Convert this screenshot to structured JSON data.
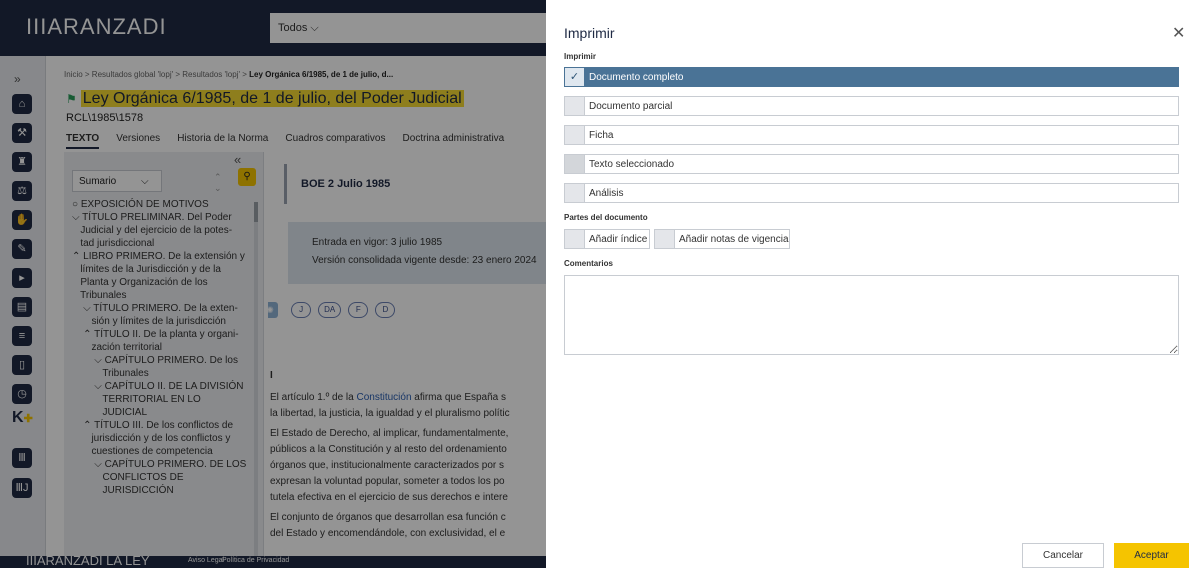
{
  "header": {
    "logo": "IIIARANZADI",
    "search_scope": "Todos ⌵"
  },
  "breadcrumb": {
    "text": "Inicio > Resultados global 'lopj' > Resultados 'lopj' > ",
    "current": "Ley Orgánica 6/1985, de 1 de julio, d..."
  },
  "document": {
    "title": "Ley Orgánica 6/1985, de 1 de julio, del Poder Judicial",
    "reference": "RCL\\1985\\1578",
    "tabs": [
      "TEXTO",
      "Versiones",
      "Historia de la Norma",
      "Cuadros comparativos",
      "Doctrina administrativa"
    ],
    "active_tab": "TEXTO"
  },
  "toc": {
    "select_value": "Sumario",
    "items": [
      "○ EXPOSICIÓN DE MOTIVOS",
      "⌵ TÍTULO PRELIMINAR. Del Poder",
      "   Judicial y del ejercicio de la potes-",
      "   tad jurisdiccional",
      "⌃ LIBRO PRIMERO. De la extensión y",
      "   límites de la Jurisdicción y de la",
      "   Planta y Organización de los",
      "   Tribunales",
      "    ⌵ TÍTULO PRIMERO. De la exten-",
      "       sión y límites de la jurisdicción",
      "    ⌃ TÍTULO II. De la planta y organi-",
      "       zación territorial",
      "        ⌵ CAPÍTULO PRIMERO. De los",
      "           Tribunales",
      "        ⌵ CAPÍTULO II. DE LA DIVISIÓN",
      "           TERRITORIAL EN LO",
      "           JUDICIAL",
      "    ⌃ TÍTULO III. De los conflictos de",
      "       jurisdicción y de los conflictos y",
      "       cuestiones de competencia",
      "        ⌵ CAPÍTULO PRIMERO. DE LOS",
      "           CONFLICTOS DE",
      "           JURISDICCIÓN"
    ]
  },
  "content": {
    "boe": "BOE 2 Julio 1985",
    "entry_force": "Entrada en vigor: 3 julio 1985",
    "consolidated": "Versión consolidada vigente desde: 23 enero 2024",
    "markers": [
      "J",
      "DA",
      "F",
      "D"
    ],
    "section": "I",
    "paragraphs": [
      [
        "El artículo 1.º de la ",
        "Constitución",
        " afirma que España s"
      ],
      [
        "la libertad, la justicia, la igualdad y el pluralismo polític",
        "",
        ""
      ],
      [
        "El Estado de Derecho, al implicar, fundamentalmente,",
        "",
        ""
      ],
      [
        "públicos a la Constitución y al resto del ordenamiento",
        "",
        ""
      ],
      [
        "órganos que, institucionalmente caracterizados por s",
        "",
        ""
      ],
      [
        "expresan la voluntad popular, someter a todos los po",
        "",
        ""
      ],
      [
        "tutela efectiva en el ejercicio de sus derechos e intere",
        "",
        ""
      ],
      [
        "El conjunto de órganos que desarrollan esa función c",
        "",
        ""
      ],
      [
        "del Estado y encomendándole, con exclusividad, el e",
        "",
        ""
      ]
    ]
  },
  "footer": {
    "logo": "IIIARANZADI LA LEY",
    "legal": "Aviso Legal",
    "privacy": "Política de Privacidad"
  },
  "dialog": {
    "title": "Imprimir",
    "print_label": "Imprimir",
    "options": [
      "Documento completo",
      "Documento parcial",
      "Ficha",
      "Texto seleccionado",
      "Análisis"
    ],
    "selected_option": "Documento completo",
    "parts_label": "Partes del documento",
    "parts": [
      "Añadir índice",
      "Añadir notas de vigencia"
    ],
    "comments_label": "Comentarios",
    "cancel": "Cancelar",
    "accept": "Aceptar"
  }
}
